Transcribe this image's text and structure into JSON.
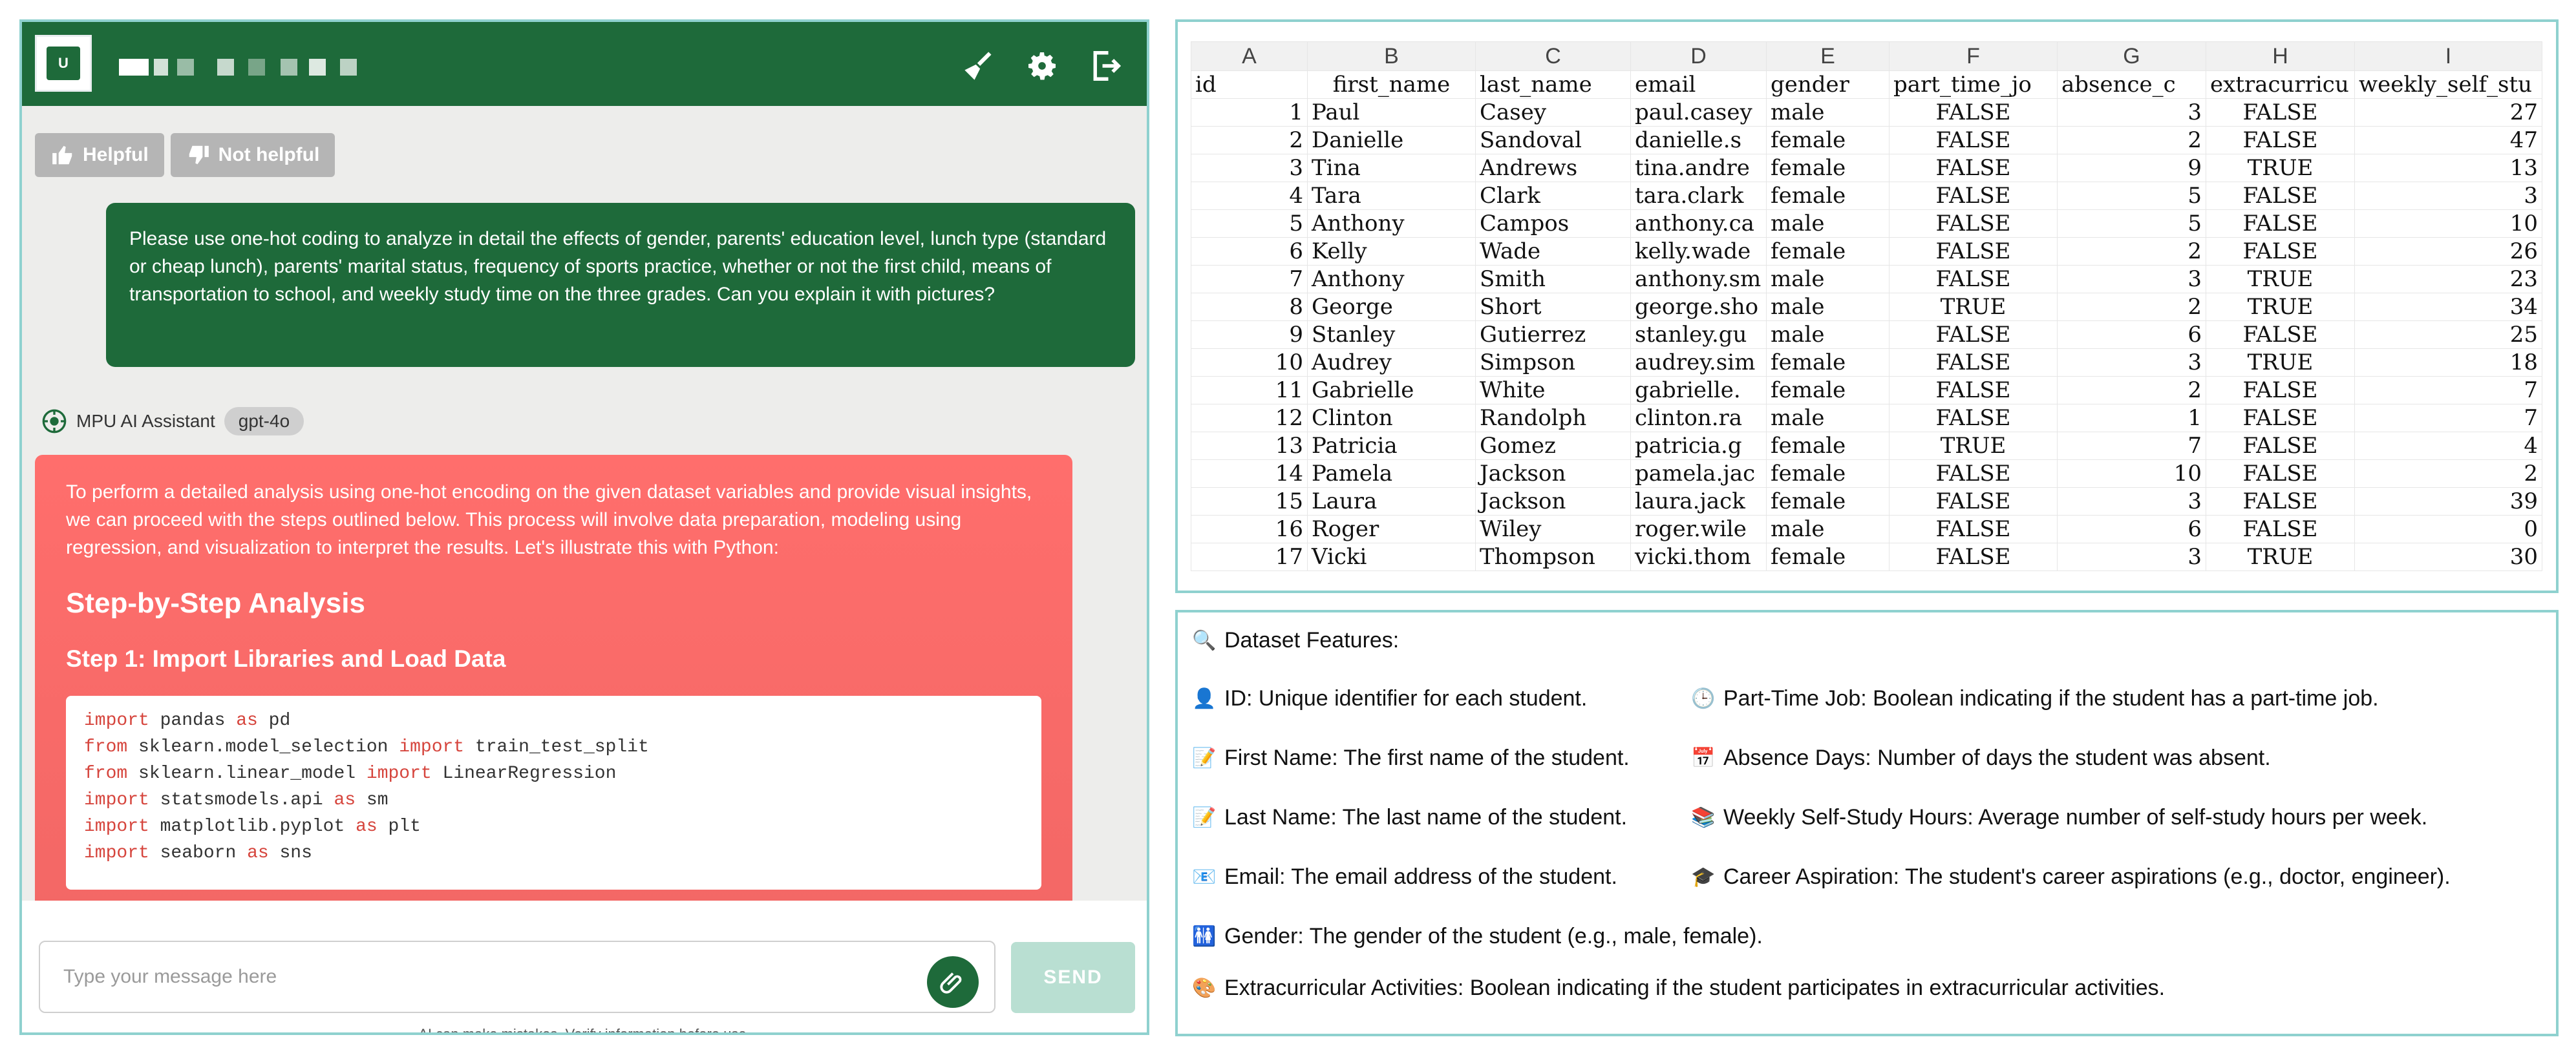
{
  "chat": {
    "feedback": {
      "helpful": "Helpful",
      "not_helpful": "Not helpful"
    },
    "user_message": "Please use one-hot coding to analyze in detail the effects of gender, parents' education level, lunch type (standard or cheap lunch), parents' marital status, frequency of sports practice, whether or not the first child, means of transportation to school, and weekly study time on the three grades. Can you explain it with pictures?",
    "assistant_name": "MPU AI Assistant",
    "model_badge": "gpt-4o",
    "assistant_intro": "To perform a detailed analysis using one-hot encoding on the given dataset variables and provide visual insights, we can proceed with the steps outlined below. This process will involve data preparation, modeling using regression, and visualization to interpret the results. Let's illustrate this with Python:",
    "heading": "Step-by-Step Analysis",
    "step1": "Step 1: Import Libraries and Load Data",
    "input_placeholder": "Type your message here",
    "send_label": "SEND",
    "disclaimer": "AI can make mistakes. Verify information before use."
  },
  "sheet": {
    "col_letters": [
      "A",
      "B",
      "C",
      "D",
      "E",
      "F",
      "G",
      "H",
      "I"
    ],
    "headers": [
      "id",
      "first_name",
      "last_name",
      "email",
      "gender",
      "part_time_jo",
      "absence_c",
      "extracurricu",
      "weekly_self_stu"
    ],
    "rows": [
      [
        "1",
        "Paul",
        "Casey",
        "paul.casey",
        "male",
        "FALSE",
        "3",
        "FALSE",
        "27"
      ],
      [
        "2",
        "Danielle",
        "Sandoval",
        "danielle.s",
        "female",
        "FALSE",
        "2",
        "FALSE",
        "47"
      ],
      [
        "3",
        "Tina",
        "Andrews",
        "tina.andre",
        "female",
        "FALSE",
        "9",
        "TRUE",
        "13"
      ],
      [
        "4",
        "Tara",
        "Clark",
        "tara.clark",
        "female",
        "FALSE",
        "5",
        "FALSE",
        "3"
      ],
      [
        "5",
        "Anthony",
        "Campos",
        "anthony.ca",
        "male",
        "FALSE",
        "5",
        "FALSE",
        "10"
      ],
      [
        "6",
        "Kelly",
        "Wade",
        "kelly.wade",
        "female",
        "FALSE",
        "2",
        "FALSE",
        "26"
      ],
      [
        "7",
        "Anthony",
        "Smith",
        "anthony.sm",
        "male",
        "FALSE",
        "3",
        "TRUE",
        "23"
      ],
      [
        "8",
        "George",
        "Short",
        "george.sho",
        "male",
        "TRUE",
        "2",
        "TRUE",
        "34"
      ],
      [
        "9",
        "Stanley",
        "Gutierrez",
        "stanley.gu",
        "male",
        "FALSE",
        "6",
        "FALSE",
        "25"
      ],
      [
        "10",
        "Audrey",
        "Simpson",
        "audrey.sim",
        "female",
        "FALSE",
        "3",
        "TRUE",
        "18"
      ],
      [
        "11",
        "Gabrielle",
        "White",
        "gabrielle.",
        "female",
        "FALSE",
        "2",
        "FALSE",
        "7"
      ],
      [
        "12",
        "Clinton",
        "Randolph",
        "clinton.ra",
        "male",
        "FALSE",
        "1",
        "FALSE",
        "7"
      ],
      [
        "13",
        "Patricia",
        "Gomez",
        "patricia.g",
        "female",
        "TRUE",
        "7",
        "FALSE",
        "4"
      ],
      [
        "14",
        "Pamela",
        "Jackson",
        "pamela.jac",
        "female",
        "FALSE",
        "10",
        "FALSE",
        "2"
      ],
      [
        "15",
        "Laura",
        "Jackson",
        "laura.jack",
        "female",
        "FALSE",
        "3",
        "FALSE",
        "39"
      ],
      [
        "16",
        "Roger",
        "Wiley",
        "roger.wile",
        "male",
        "FALSE",
        "6",
        "FALSE",
        "0"
      ],
      [
        "17",
        "Vicki",
        "Thompson",
        "vicki.thom",
        "female",
        "FALSE",
        "3",
        "TRUE",
        "30"
      ]
    ]
  },
  "features": {
    "title": "Dataset Features:",
    "items": [
      {
        "icon": "person-icon",
        "text": "ID: Unique identifier for each student."
      },
      {
        "icon": "clock-icon",
        "text": "Part-Time Job: Boolean indicating if the student has a part-time job."
      },
      {
        "icon": "pencil-icon",
        "text": "First Name: The first name of the student."
      },
      {
        "icon": "calendar-icon",
        "text": "Absence Days: Number of days the student was absent."
      },
      {
        "icon": "pencil-icon",
        "text": "Last Name: The last name of the student."
      },
      {
        "icon": "books-icon",
        "text": "Weekly Self-Study Hours: Average number of self-study hours per week."
      },
      {
        "icon": "email-icon",
        "text": "Email: The email address of the student."
      },
      {
        "icon": "graduation-cap-icon",
        "text": "Career Aspiration: The student's career aspirations (e.g., doctor, engineer)."
      },
      {
        "icon": "restroom-icon",
        "text": "Gender: The gender of the student (e.g., male, female)."
      },
      {
        "icon": "palette-icon",
        "text": "Extracurricular Activities: Boolean indicating if the student participates in extracurricular activities."
      }
    ]
  }
}
